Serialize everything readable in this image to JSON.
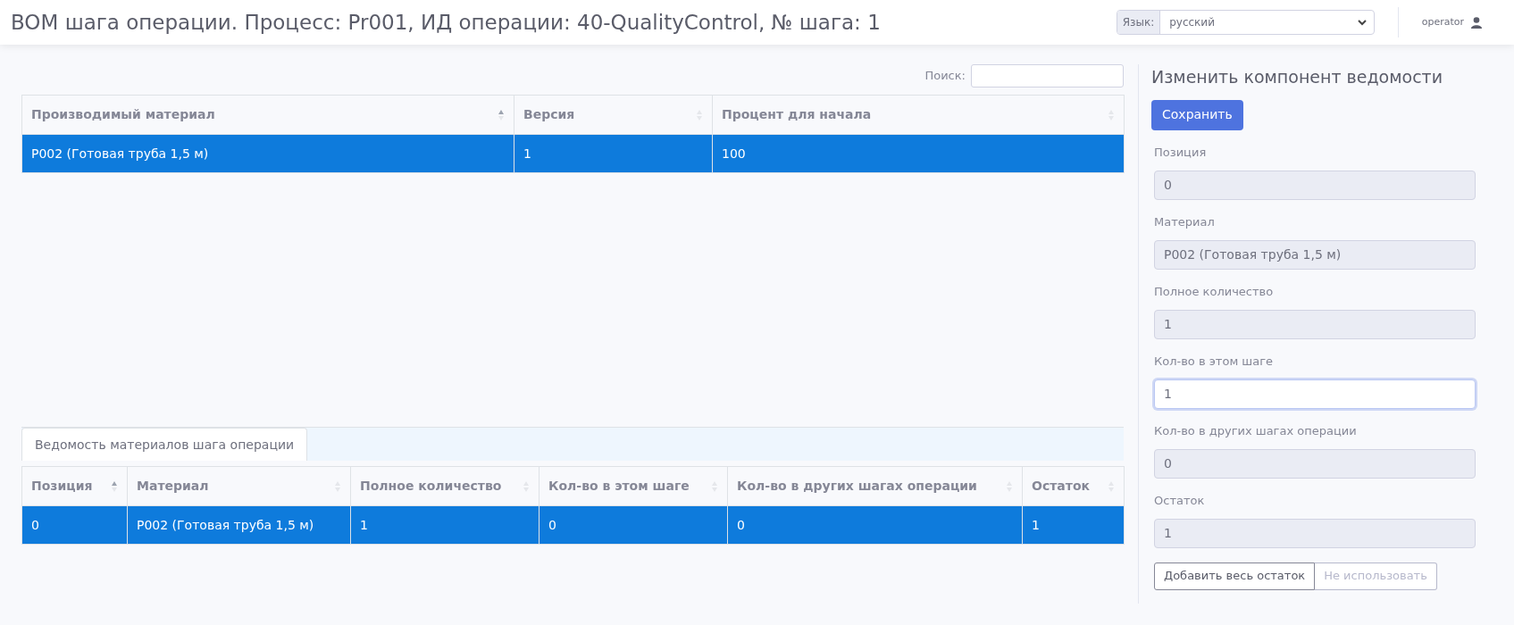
{
  "header": {
    "title": "BOM шага операции. Процесс: Pr001, ИД операции: 40-QualityControl, № шага: 1",
    "language_label": "Язык:",
    "language_value": "русский",
    "user": "operator"
  },
  "search": {
    "label": "Поиск:"
  },
  "top_table": {
    "columns": [
      {
        "label": "Производимый материал",
        "sorted": true
      },
      {
        "label": "Версия",
        "sorted": false
      },
      {
        "label": "Процент для начала",
        "sorted": false
      }
    ],
    "rows": [
      {
        "selected": true,
        "cells": [
          "P002 (Готовая труба 1,5 м)",
          "1",
          "100"
        ]
      }
    ]
  },
  "tabs": [
    {
      "label": "Ведомость материалов шага операции",
      "selected": true
    }
  ],
  "bottom_table": {
    "columns": [
      {
        "label": "Позиция",
        "sorted": true
      },
      {
        "label": "Материал",
        "sorted": false
      },
      {
        "label": "Полное количество",
        "sorted": false
      },
      {
        "label": "Кол-во в этом шаге",
        "sorted": false
      },
      {
        "label": "Кол-во в других шагах операции",
        "sorted": false
      },
      {
        "label": "Остаток",
        "sorted": false
      }
    ],
    "rows": [
      {
        "selected": true,
        "cells": [
          "0",
          "P002 (Готовая труба 1,5 м)",
          "1",
          "0",
          "0",
          "1"
        ]
      }
    ]
  },
  "edit_panel": {
    "title": "Изменить компонент ведомости",
    "save_button": "Сохранить",
    "fields": [
      {
        "label": "Позиция",
        "value": "0",
        "disabled": true,
        "focused": false
      },
      {
        "label": "Материал",
        "value": "P002 (Готовая труба 1,5 м)",
        "disabled": true,
        "focused": false
      },
      {
        "label": "Полное количество",
        "value": "1",
        "disabled": true,
        "focused": false
      },
      {
        "label": "Кол-во в этом шаге",
        "value": "1",
        "disabled": false,
        "focused": true
      },
      {
        "label": "Кол-во в других шагах операции",
        "value": "0",
        "disabled": true,
        "focused": false
      },
      {
        "label": "Остаток",
        "value": "1",
        "disabled": true,
        "focused": false
      }
    ],
    "buttons": [
      {
        "label": "Добавить весь остаток",
        "disabled": false
      },
      {
        "label": "Не использовать",
        "disabled": true
      }
    ]
  }
}
